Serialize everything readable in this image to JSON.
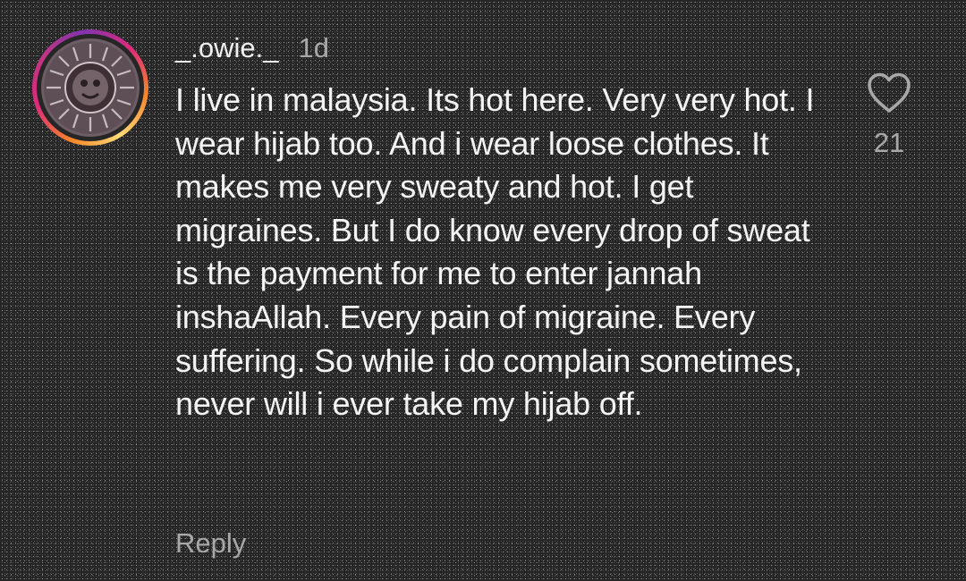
{
  "comment": {
    "username": "_.owie._",
    "time": "1d",
    "text": "I live in malaysia. Its hot here. Very very hot. I wear hijab too. And i wear loose clothes. It makes me very sweaty and hot. I get migraines. But I do know every drop of sweat is the payment for me to enter jannah inshaAllah. Every pain of migraine. Every suffering. So while i do complain sometimes, never will i ever take my hijab off.",
    "reply_label": "Reply",
    "like_count": "21",
    "like_icon": "heart-outline-icon"
  },
  "colors": {
    "background": "#262626",
    "text_primary": "#f3f3f3",
    "text_secondary": "#a8a8a8",
    "story_ring": [
      "#f58529",
      "#dd2a7b",
      "#8134af"
    ]
  }
}
